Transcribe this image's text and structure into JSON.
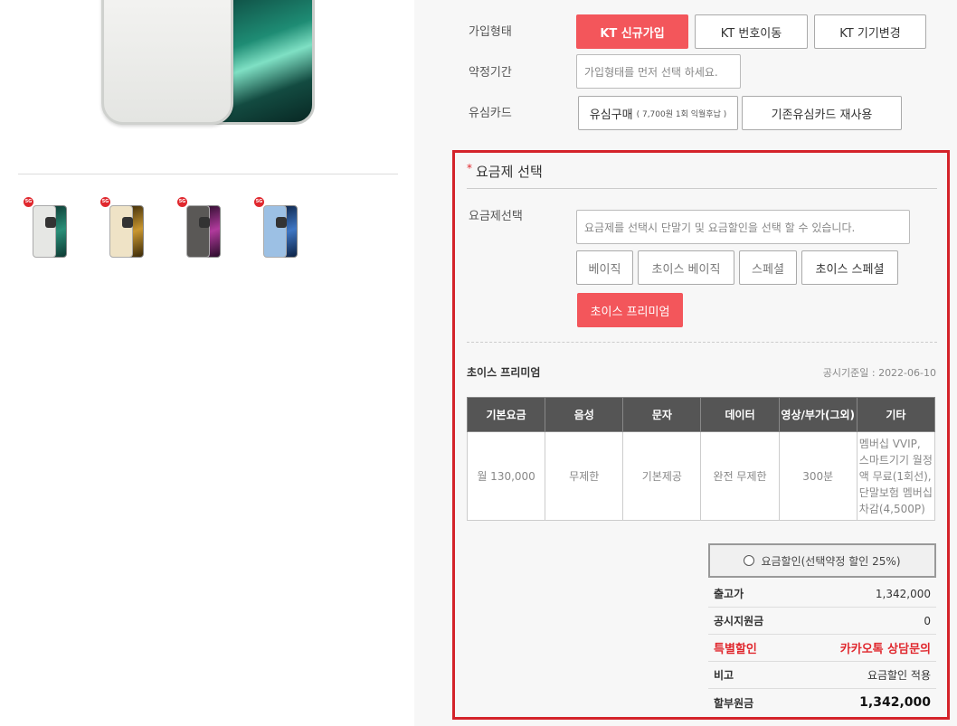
{
  "product": {
    "thumbnails": [
      {
        "badge": "5G",
        "color_front": "#e6e7e4",
        "color_back": "#2a8f78"
      },
      {
        "badge": "5G",
        "color_front": "#efe3c6",
        "color_back": "#c9962f"
      },
      {
        "badge": "5G",
        "color_front": "#5a5856",
        "color_back": "#b03a9c"
      },
      {
        "badge": "5G",
        "color_front": "#9cc0e4",
        "color_back": "#3f77c4"
      }
    ]
  },
  "form": {
    "join_type": {
      "label": "가입형태",
      "options": [
        "KT 신규가입",
        "KT 번호이동",
        "KT 기기변경"
      ],
      "selected": "KT 신규가입"
    },
    "contract": {
      "label": "약정기간",
      "placeholder": "가입형태를 먼저 선택 하세요."
    },
    "usim": {
      "label": "유심카드",
      "buy_label": "유심구매",
      "buy_note": "( 7,700원 1회 익월후납 )",
      "reuse_label": "기존유심카드 재사용"
    }
  },
  "plan_section": {
    "title": "요금제 선택",
    "select_label": "요금제선택",
    "select_placeholder": "요금제를 선택시 단말기 및 요금할인을 선택 할 수 있습니다.",
    "plans": [
      "베이직",
      "초이스 베이직",
      "스페셜",
      "초이스 스페셜",
      "초이스 프리미엄"
    ],
    "selected_plan": "초이스 프리미엄",
    "plan_name": "초이스 프리미엄",
    "notice_date": "공시기준일 : 2022-06-10",
    "table": {
      "headers": [
        "기본요금",
        "음성",
        "문자",
        "데이터",
        "영상/부가(그외)",
        "기타"
      ],
      "row": [
        "월 130,000",
        "무제한",
        "기본제공",
        "완전 무제한",
        "300분",
        "멤버십 VVIP, 스마트기기 월정액 무료(1회선), 단말보험 멤버십 차감(4,500P)"
      ]
    },
    "discount_label": "요금할인(선택약정 할인 25%)",
    "prices": [
      {
        "key": "출고가",
        "value": "1,342,000"
      },
      {
        "key": "공시지원금",
        "value": "0"
      },
      {
        "key": "특별할인",
        "value": "카카오톡 상담문의"
      },
      {
        "key": "비고",
        "value": "요금할인 적용"
      },
      {
        "key": "할부원금",
        "value": "1,342,000"
      }
    ]
  },
  "colors": {
    "accent": "#f3565b",
    "highlight_border": "#d4232a",
    "header_bg": "#555555"
  }
}
